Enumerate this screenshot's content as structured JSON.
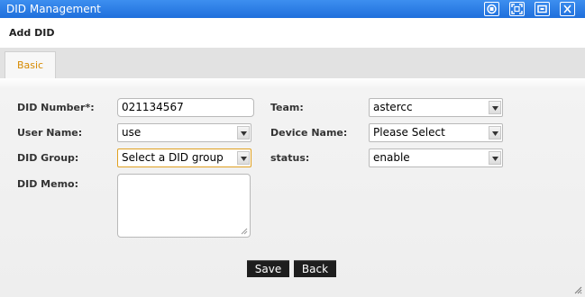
{
  "window": {
    "title": "DID Management",
    "controls": [
      "restore-icon",
      "maximize-icon",
      "minimize-icon",
      "close-icon"
    ]
  },
  "page": {
    "title": "Add DID"
  },
  "tabs": [
    {
      "label": "Basic",
      "active": true
    }
  ],
  "form": {
    "did_number": {
      "label": "DID Number*:",
      "value": "021134567"
    },
    "user_name": {
      "label": "User Name:",
      "value": "use"
    },
    "did_group": {
      "label": "DID Group:",
      "value": "Select a DID group"
    },
    "did_memo": {
      "label": "DID Memo:",
      "value": ""
    },
    "team": {
      "label": "Team:",
      "value": "astercc"
    },
    "device_name": {
      "label": "Device Name:",
      "value": "Please Select"
    },
    "status": {
      "label": "status:",
      "value": "enable"
    }
  },
  "buttons": {
    "save": "Save",
    "back": "Back"
  },
  "colors": {
    "titlebar": "#1f6fdc",
    "tab_text": "#d68a00",
    "button_bg": "#1e1e1e",
    "focus_border": "#e0a020"
  }
}
